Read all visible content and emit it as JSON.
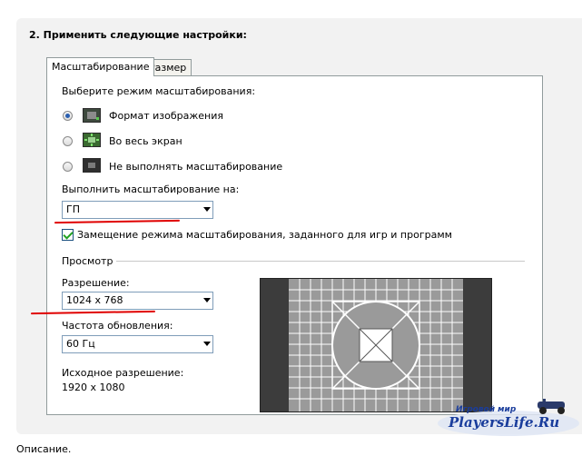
{
  "section_title": "2. Применить следующие настройки:",
  "tabs": [
    {
      "label": "Масштабирование",
      "active": true
    },
    {
      "label": "Размер",
      "active": false
    }
  ],
  "scaling": {
    "prompt": "Выберите режим масштабирования:",
    "modes": [
      {
        "label": "Формат изображения",
        "selected": true,
        "icon": "aspect-ratio-icon"
      },
      {
        "label": "Во весь экран",
        "selected": false,
        "icon": "fullscreen-icon"
      },
      {
        "label": "Не выполнять масштабирование",
        "selected": false,
        "icon": "no-scaling-icon"
      }
    ],
    "perform_on_label": "Выполнить масштабирование на:",
    "perform_on_value": "ГП",
    "override_checkbox_label": "Замещение режима масштабирования, заданного для игр и программ",
    "override_checked": true
  },
  "preview": {
    "group_label": "Просмотр",
    "resolution_label": "Разрешение:",
    "resolution_value": "1024 x 768",
    "refresh_label": "Частота обновления:",
    "refresh_value": "60 Гц",
    "native_label": "Исходное разрешение:",
    "native_value": "1920 x 1080"
  },
  "watermark": {
    "line1": "Игровой мир",
    "line2": "PlayersLife.Ru"
  },
  "description_label": "Описание.",
  "colors": {
    "accent_red": "#e00000",
    "watermark_blue": "#1a3d9c",
    "preview_dark": "#3c3c3c",
    "preview_gray": "#9a9a9a"
  }
}
